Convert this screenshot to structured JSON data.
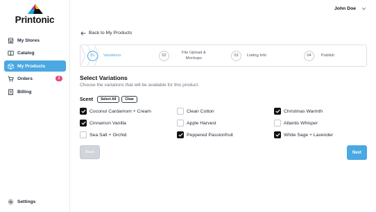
{
  "brand": {
    "name": "Printonic"
  },
  "sidebar": {
    "items": [
      {
        "label": "My Stores",
        "icon": "store-icon"
      },
      {
        "label": "Catalog",
        "icon": "book-icon"
      },
      {
        "label": "My Products",
        "icon": "box-icon",
        "active": true
      },
      {
        "label": "Orders",
        "icon": "cart-icon",
        "badge": "2"
      },
      {
        "label": "Billing",
        "icon": "receipt-icon"
      }
    ],
    "settings_label": "Settings"
  },
  "header": {
    "user_name": "John Doe"
  },
  "main": {
    "back_label": "Back to My Products",
    "steps": [
      {
        "num": "01",
        "label": "Variations",
        "active": true
      },
      {
        "num": "02",
        "label_line1": "File Upload &",
        "label_line2": "Mockups"
      },
      {
        "num": "03",
        "label": "Listing Info"
      },
      {
        "num": "04",
        "label": "Publish"
      }
    ],
    "section_title": "Select Variations",
    "section_subtitle": "Choose the variations that will be available for this product.",
    "scent_label": "Scent",
    "select_all_label": "Select All",
    "clear_label": "Clear",
    "options": [
      {
        "label": "Coconut Cardamom + Cream",
        "checked": true
      },
      {
        "label": "Clean Cotton",
        "checked": false
      },
      {
        "label": "Christmas Warmth",
        "checked": true
      },
      {
        "label": "Cinnamon Vanilla",
        "checked": true
      },
      {
        "label": "Apple Harvest",
        "checked": false
      },
      {
        "label": "Atlantis Whisper",
        "checked": false
      },
      {
        "label": "Sea Salt + Orchid",
        "checked": false
      },
      {
        "label": "Peppered Passionfruit",
        "checked": true
      },
      {
        "label": "White Sage + Lavender",
        "checked": true
      }
    ],
    "back_button_label": "Back",
    "next_button_label": "Next"
  },
  "colors": {
    "accent": "#4aa8e2",
    "badge": "#e84a7a",
    "checkbox_checked": "#111111"
  }
}
